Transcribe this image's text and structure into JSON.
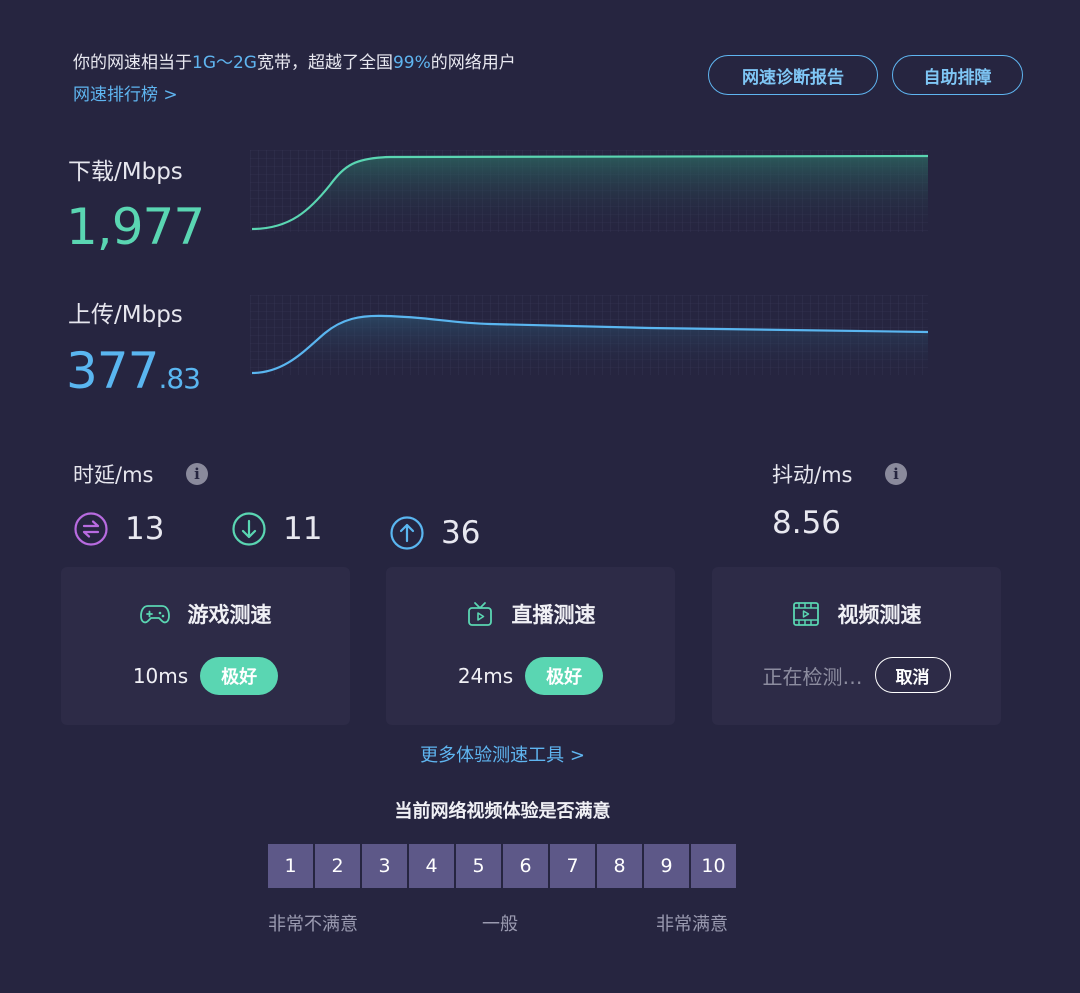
{
  "summary": {
    "prefix": "你的网速相当于",
    "bandwidth": "1G～2G",
    "middle": "宽带，超越了全国",
    "percent": "99%",
    "suffix": "的网络用户",
    "rank_link": "网速排行榜 >"
  },
  "header_buttons": {
    "diagnosis": "网速诊断报告",
    "troubleshoot": "自助排障"
  },
  "download": {
    "label": "下载/Mbps",
    "value": "1,977",
    "color": "#5ad6b2"
  },
  "upload": {
    "label": "上传/Mbps",
    "value_int": "377",
    "value_frac": ".83",
    "color": "#5ab6f0"
  },
  "latency": {
    "label": "时延/ms",
    "info_icon": "info-icon",
    "overall": {
      "icon": "swap-arrows-icon",
      "value": "13",
      "color": "#b86be0"
    },
    "down": {
      "icon": "arrow-down-circle-icon",
      "value": "11",
      "color": "#5ad6b2"
    },
    "up": {
      "icon": "arrow-up-circle-icon",
      "value": "36",
      "color": "#5ab6f0"
    }
  },
  "jitter": {
    "label": "抖动/ms",
    "info_icon": "info-icon",
    "value": "8.56"
  },
  "cards": {
    "game": {
      "icon": "gamepad-icon",
      "title": "游戏测速",
      "value": "10ms",
      "badge": "极好"
    },
    "live": {
      "icon": "tv-icon",
      "title": "直播测速",
      "value": "24ms",
      "badge": "极好"
    },
    "video": {
      "icon": "film-icon",
      "title": "视频测速",
      "status": "正在检测…",
      "cancel": "取消"
    }
  },
  "more_tools": "更多体验测速工具 >",
  "survey": {
    "question": "当前网络视频体验是否满意",
    "scores": [
      "1",
      "2",
      "3",
      "4",
      "5",
      "6",
      "7",
      "8",
      "9",
      "10"
    ],
    "low_label": "非常不满意",
    "mid_label": "一般",
    "high_label": "非常满意"
  },
  "colors": {
    "background": "#262540",
    "card": "#2d2b47",
    "accent_blue": "#5fb5f0",
    "accent_green": "#5ad6b2",
    "rating_cell": "#5d5888"
  }
}
